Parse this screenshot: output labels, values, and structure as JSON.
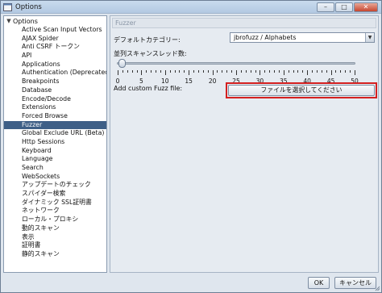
{
  "window": {
    "title": "Options",
    "minimize": "–",
    "maximize": "□",
    "close": "✕"
  },
  "tree": {
    "root_label": "Options",
    "root_caret": "▼",
    "items": [
      "Active Scan Input Vectors",
      "AJAX Spider",
      "Anti CSRF トークン",
      "API",
      "Applications",
      "Authentication (Deprecated)",
      "Breakpoints",
      "Database",
      "Encode/Decode",
      "Extensions",
      "Forced Browse",
      "Fuzzer",
      "Global Exclude URL (Beta)",
      "Http Sessions",
      "Keyboard",
      "Language",
      "Search",
      "WebSockets",
      "アップデートのチェック",
      "スパイダー検索",
      "ダイナミック SSL証明書",
      "ネットワーク",
      "ローカル・プロキシ",
      "動的スキャン",
      "表示",
      "証明書",
      "静的スキャン"
    ],
    "selected": "Fuzzer"
  },
  "panel": {
    "header": "Fuzzer",
    "category_label": "デフォルトカテゴリー:",
    "category_value": "jbrofuzz / Alphabets",
    "category_arrow": "▼",
    "threads_label": "並列スキャンスレッド数:",
    "threads_value": 1,
    "slider_min": 0,
    "slider_max": 50,
    "slider_ticks": [
      "0",
      "5",
      "10",
      "15",
      "20",
      "25",
      "30",
      "35",
      "40",
      "45",
      "50"
    ],
    "fuzz_file_label": "Add custom Fuzz file:",
    "file_button": "ファイルを選択してください"
  },
  "buttons": {
    "ok": "OK",
    "cancel": "キャンセル"
  },
  "colors": {
    "selection": "#3e5f87",
    "highlight": "#d42020"
  }
}
